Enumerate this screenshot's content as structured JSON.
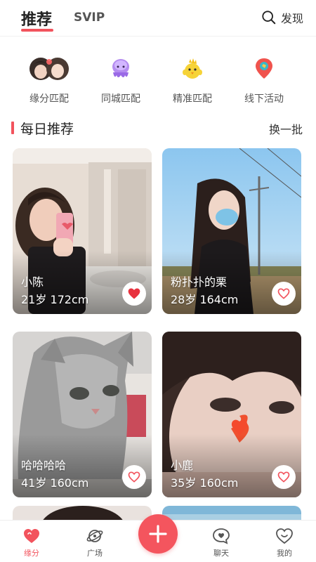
{
  "header": {
    "tabs": [
      "推荐",
      "SVIP"
    ],
    "active_tab": "推荐",
    "discover_label": "发现"
  },
  "categories": [
    {
      "label": "缘分匹配",
      "icon": "avatar-pair-icon"
    },
    {
      "label": "同城匹配",
      "icon": "octopus-icon"
    },
    {
      "label": "精准匹配",
      "icon": "chick-icon"
    },
    {
      "label": "线下活动",
      "icon": "map-pin-icon"
    }
  ],
  "section": {
    "title": "每日推荐",
    "refresh_label": "换一批"
  },
  "cards": [
    {
      "name": "小陈",
      "info": "21岁 172cm",
      "liked": true
    },
    {
      "name": "粉扑扑的栗",
      "info": "28岁 164cm",
      "liked": false
    },
    {
      "name": "哈哈哈哈",
      "info": "41岁 160cm",
      "liked": false
    },
    {
      "name": "小鹿",
      "info": "35岁 160cm",
      "liked": false
    }
  ],
  "nav": {
    "items": [
      {
        "label": "缘分",
        "icon": "heart-icon",
        "active": true
      },
      {
        "label": "广场",
        "icon": "planet-icon",
        "active": false
      },
      {
        "label": "聊天",
        "icon": "chat-heart-icon",
        "active": false
      },
      {
        "label": "我的",
        "icon": "profile-heart-icon",
        "active": false
      }
    ],
    "fab_icon": "plus-icon"
  },
  "colors": {
    "accent": "#f2535d",
    "like_active": "#e8323e"
  }
}
